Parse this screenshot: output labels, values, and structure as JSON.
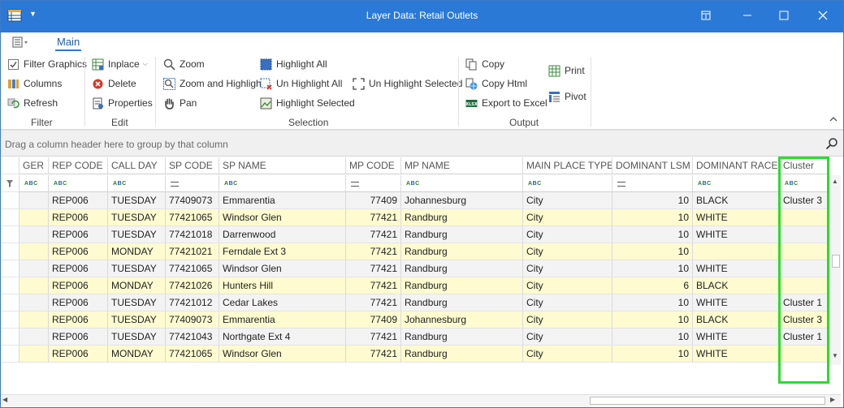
{
  "window": {
    "title": "Layer Data: Retail Outlets",
    "title_color": "#2b79d6"
  },
  "ribbon": {
    "tab": "Main",
    "groups": {
      "filter": {
        "label": "Filter",
        "items": [
          "Filter Graphics",
          "Columns",
          "Refresh"
        ]
      },
      "edit": {
        "label": "Edit",
        "items": [
          "Inplace",
          "Delete",
          "Properties"
        ]
      },
      "selection": {
        "label": "Selection",
        "items": [
          "Zoom",
          "Zoom and Highlight",
          "Pan",
          "Highlight All",
          "Un Highlight All",
          "Highlight Selected",
          "Un Highlight Selected"
        ]
      },
      "output": {
        "label": "Output",
        "items": [
          "Copy",
          "Copy Html",
          "Export to Excel",
          "Print",
          "Pivot"
        ]
      }
    }
  },
  "groupbar": {
    "hint": "Drag a column header here to group by that column"
  },
  "grid": {
    "columns": [
      "GER",
      "REP CODE",
      "CALL DAY",
      "SP CODE",
      "SP NAME",
      "MP CODE",
      "MP NAME",
      "MAIN PLACE TYPE",
      "DOMINANT LSM",
      "DOMINANT RACE",
      "Cluster"
    ],
    "rows": [
      [
        "",
        "REP006",
        "TUESDAY",
        "77409073",
        "Emmarentia",
        "77409",
        "Johannesburg",
        "City",
        "10",
        "BLACK",
        "Cluster 3"
      ],
      [
        "",
        "REP006",
        "TUESDAY",
        "77421065",
        "Windsor Glen",
        "77421",
        "Randburg",
        "City",
        "10",
        "WHITE",
        ""
      ],
      [
        "",
        "REP006",
        "TUESDAY",
        "77421018",
        "Darrenwood",
        "77421",
        "Randburg",
        "City",
        "10",
        "WHITE",
        ""
      ],
      [
        "",
        "REP006",
        "MONDAY",
        "77421021",
        "Ferndale Ext 3",
        "77421",
        "Randburg",
        "City",
        "10",
        "",
        ""
      ],
      [
        "",
        "REP006",
        "TUESDAY",
        "77421065",
        "Windsor Glen",
        "77421",
        "Randburg",
        "City",
        "10",
        "WHITE",
        ""
      ],
      [
        "",
        "REP006",
        "MONDAY",
        "77421026",
        "Hunters Hill",
        "77421",
        "Randburg",
        "City",
        "6",
        "BLACK",
        ""
      ],
      [
        "",
        "REP006",
        "TUESDAY",
        "77421012",
        "Cedar Lakes",
        "77421",
        "Randburg",
        "City",
        "10",
        "WHITE",
        "Cluster 1"
      ],
      [
        "",
        "REP006",
        "TUESDAY",
        "77409073",
        "Emmarentia",
        "77409",
        "Johannesburg",
        "City",
        "10",
        "BLACK",
        "Cluster 3"
      ],
      [
        "",
        "REP006",
        "TUESDAY",
        "77421043",
        "Northgate Ext 4",
        "77421",
        "Randburg",
        "City",
        "10",
        "WHITE",
        "Cluster 1"
      ],
      [
        "",
        "REP006",
        "MONDAY",
        "77421065",
        "Windsor Glen",
        "77421",
        "Randburg",
        "City",
        "10",
        "WHITE",
        ""
      ]
    ]
  },
  "colors": {
    "row_alt": "#fdfbcf",
    "row": "#f3f3f3",
    "highlight_box": "#2bdc2b"
  },
  "icons": [
    "app-icon",
    "dropdown-icon",
    "restore-icon",
    "maximize-icon",
    "close-icon",
    "search-icon",
    "filter-icon"
  ]
}
